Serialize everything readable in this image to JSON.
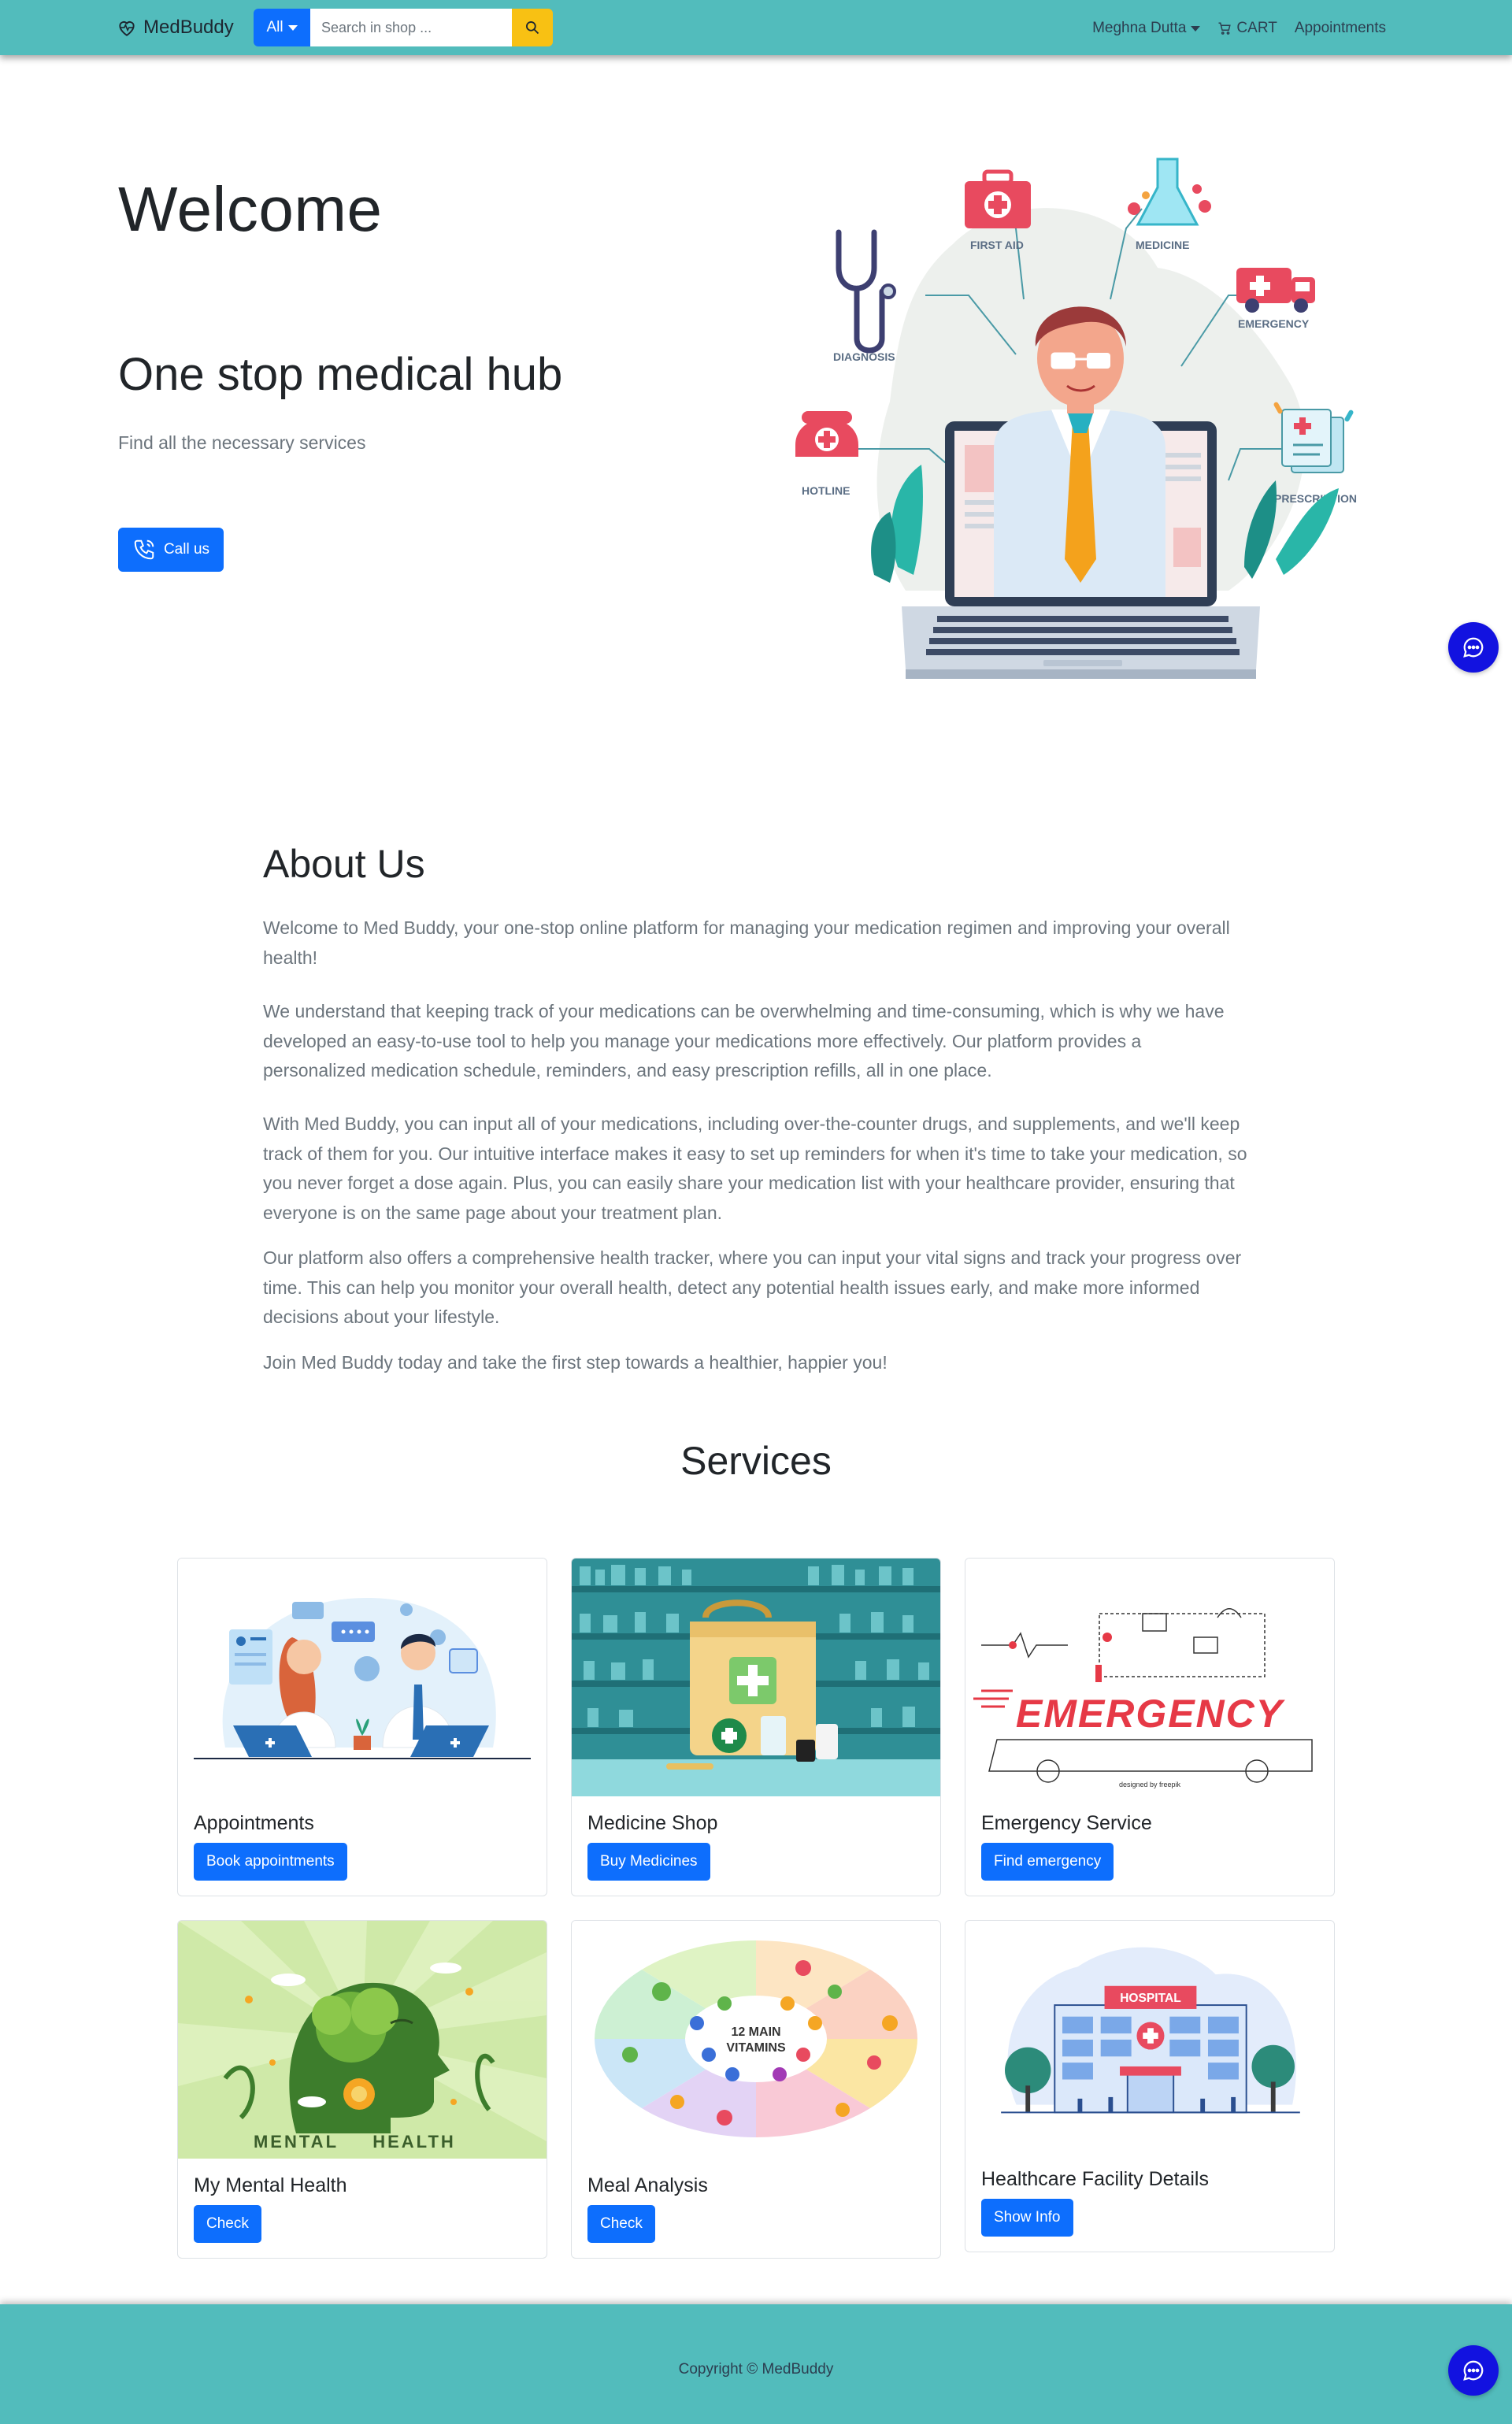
{
  "navbar": {
    "brand": "MedBuddy",
    "category_label": "All",
    "search_placeholder": "Search in shop ...",
    "user_name": "Meghna Dutta",
    "cart_label": "CART",
    "appointments_label": "Appointments",
    "bg_color": "#52bcbc"
  },
  "hero": {
    "welcome": "Welcome",
    "headline": "One stop medical hub",
    "subtext": "Find all the necessary services",
    "call_button": "Call us",
    "illustration_labels": {
      "first_aid": "FIRST AID",
      "medicine": "MEDICINE",
      "diagnosis": "DIAGNOSIS",
      "emergency": "EMERGENCY",
      "hotline": "HOTLINE",
      "prescription": "PRESCRIPTION"
    }
  },
  "about": {
    "title": "About Us",
    "paragraphs": [
      "Welcome to Med Buddy, your one-stop online platform for managing your medication regimen and improving your overall health!",
      "We understand that keeping track of your medications can be overwhelming and time-consuming, which is why we have developed an easy-to-use tool to help you manage your medications more effectively. Our platform provides a personalized medication schedule, reminders, and easy prescription refills, all in one place.",
      "With Med Buddy, you can input all of your medications, including over-the-counter drugs, and supplements, and we'll keep track of them for you. Our intuitive interface makes it easy to set up reminders for when it's time to take your medication, so you never forget a dose again. Plus, you can easily share your medication list with your healthcare provider, ensuring that everyone is on the same page about your treatment plan.",
      "Our platform also offers a comprehensive health tracker, where you can input your vital signs and track your progress over time. This can help you monitor your overall health, detect any potential health issues early, and make more informed decisions about your lifestyle.",
      "Join Med Buddy today and take the first step towards a healthier, happier you!"
    ]
  },
  "services": {
    "title": "Services",
    "cards": [
      {
        "title": "Appointments",
        "button": "Book appointments"
      },
      {
        "title": "Medicine Shop",
        "button": "Buy Medicines"
      },
      {
        "title": "Emergency Service",
        "button": "Find emergency"
      },
      {
        "title": "My Mental Health",
        "button": "Check"
      },
      {
        "title": "Meal Analysis",
        "button": "Check"
      },
      {
        "title": "Healthcare Facility Details",
        "button": "Show Info"
      }
    ],
    "image_text": {
      "emergency": "EMERGENCY",
      "emergency_credit": "designed by freepik",
      "mental_health_1": "MENTAL",
      "mental_health_2": "HEALTH",
      "vitamins_1": "12 MAIN",
      "vitamins_2": "VITAMINS",
      "hospital": "HOSPITAL"
    }
  },
  "footer": {
    "copyright": "Copyright © MedBuddy",
    "bg_color": "#52bcbc"
  },
  "colors": {
    "primary": "#0d6efd",
    "search_button": "#f8c113",
    "chat_bubble": "#1212e0"
  }
}
